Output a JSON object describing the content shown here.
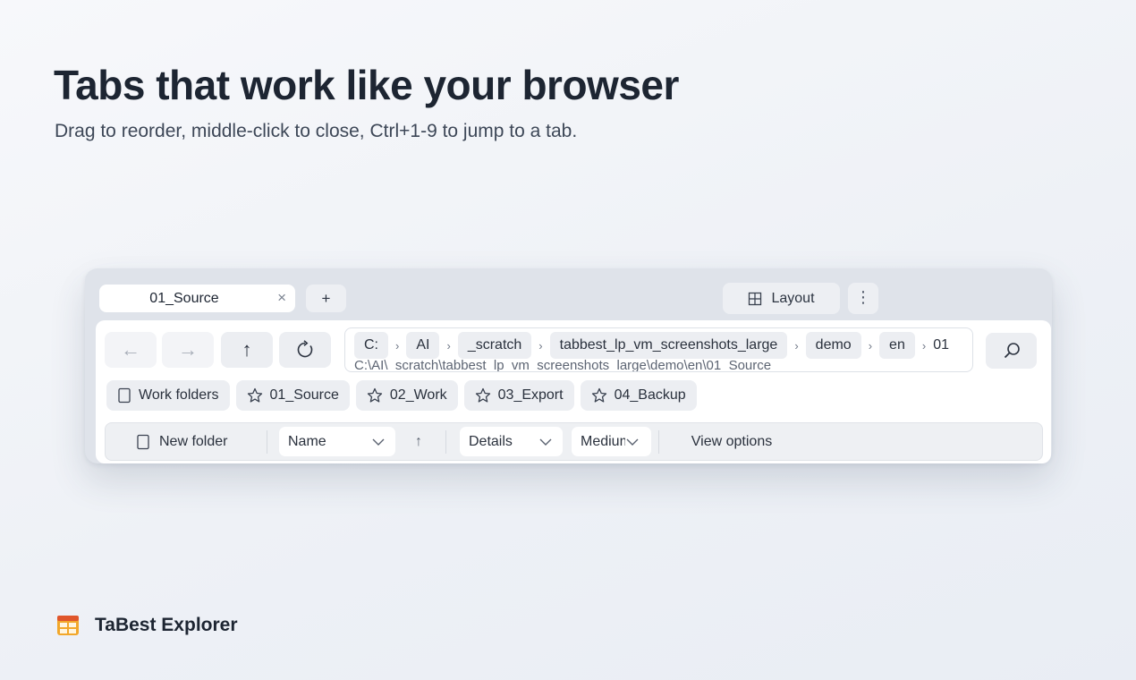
{
  "hero": {
    "title": "Tabs that work like your browser",
    "subtitle": "Drag to reorder, middle-click to close, Ctrl+1-9 to jump to a tab."
  },
  "window": {
    "tab": {
      "label": "01_Source",
      "close": "×"
    },
    "new_tab": "+",
    "layout_button": "Layout",
    "more_button": "⋮",
    "nav": {
      "back_icon": "arrow-left-icon",
      "forward_icon": "arrow-right-icon",
      "up_icon": "arrow-up-icon",
      "refresh_icon": "refresh-icon",
      "back": "←",
      "forward": "→",
      "up": "↑"
    },
    "address": {
      "crumbs": [
        "C:",
        "AI",
        "_scratch",
        "tabbest_lp_vm_screenshots_large",
        "demo",
        "en"
      ],
      "separator": "›",
      "tail": "01",
      "path": "C:\\AI\\_scratch\\tabbest_lp_vm_screenshots_large\\demo\\en\\01_Source"
    },
    "favorites": [
      {
        "label": "Work folders",
        "icon": "folder-icon"
      },
      {
        "label": "01_Source",
        "icon": "star-icon"
      },
      {
        "label": "02_Work",
        "icon": "star-icon"
      },
      {
        "label": "03_Export",
        "icon": "star-icon"
      },
      {
        "label": "04_Backup",
        "icon": "star-icon"
      }
    ],
    "toolbar": {
      "new_folder": "New folder",
      "sort_field": "Name",
      "sort_dir": "↑",
      "view_mode": "Details",
      "icon_size": "Medium",
      "view_options": "View options"
    }
  },
  "brand": {
    "name": "TaBest Explorer"
  }
}
